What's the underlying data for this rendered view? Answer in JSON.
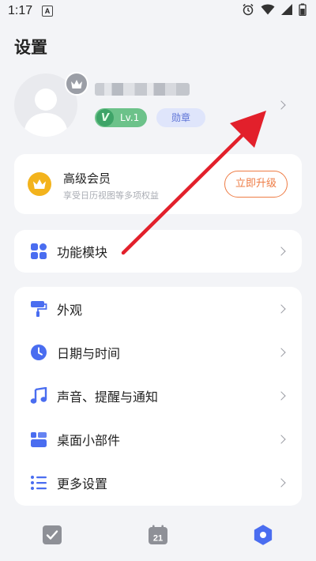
{
  "status_bar": {
    "time": "1:17",
    "notification_letter": "A"
  },
  "header": {
    "title": "设置"
  },
  "profile": {
    "level": "Lv.1",
    "medal_label": "勋章"
  },
  "vip": {
    "title": "高级会员",
    "description": "享受日历视图等多项权益",
    "upgrade_label": "立即升级"
  },
  "modules": {
    "label": "功能模块"
  },
  "settings_group": [
    {
      "label": "外观",
      "icon": "paint-roller-icon"
    },
    {
      "label": "日期与时间",
      "icon": "clock-icon"
    },
    {
      "label": "声音、提醒与通知",
      "icon": "music-note-icon"
    },
    {
      "label": "桌面小部件",
      "icon": "widgets-icon"
    },
    {
      "label": "更多设置",
      "icon": "list-settings-icon"
    }
  ],
  "tabbar": {
    "calendar_day": "21"
  },
  "colors": {
    "accent": "#4a6df0",
    "vip_gold": "#f3b31c",
    "upgrade_orange": "#ee7c45",
    "level_green": "#6cc28a",
    "annotation_arrow": "#e2202b"
  }
}
